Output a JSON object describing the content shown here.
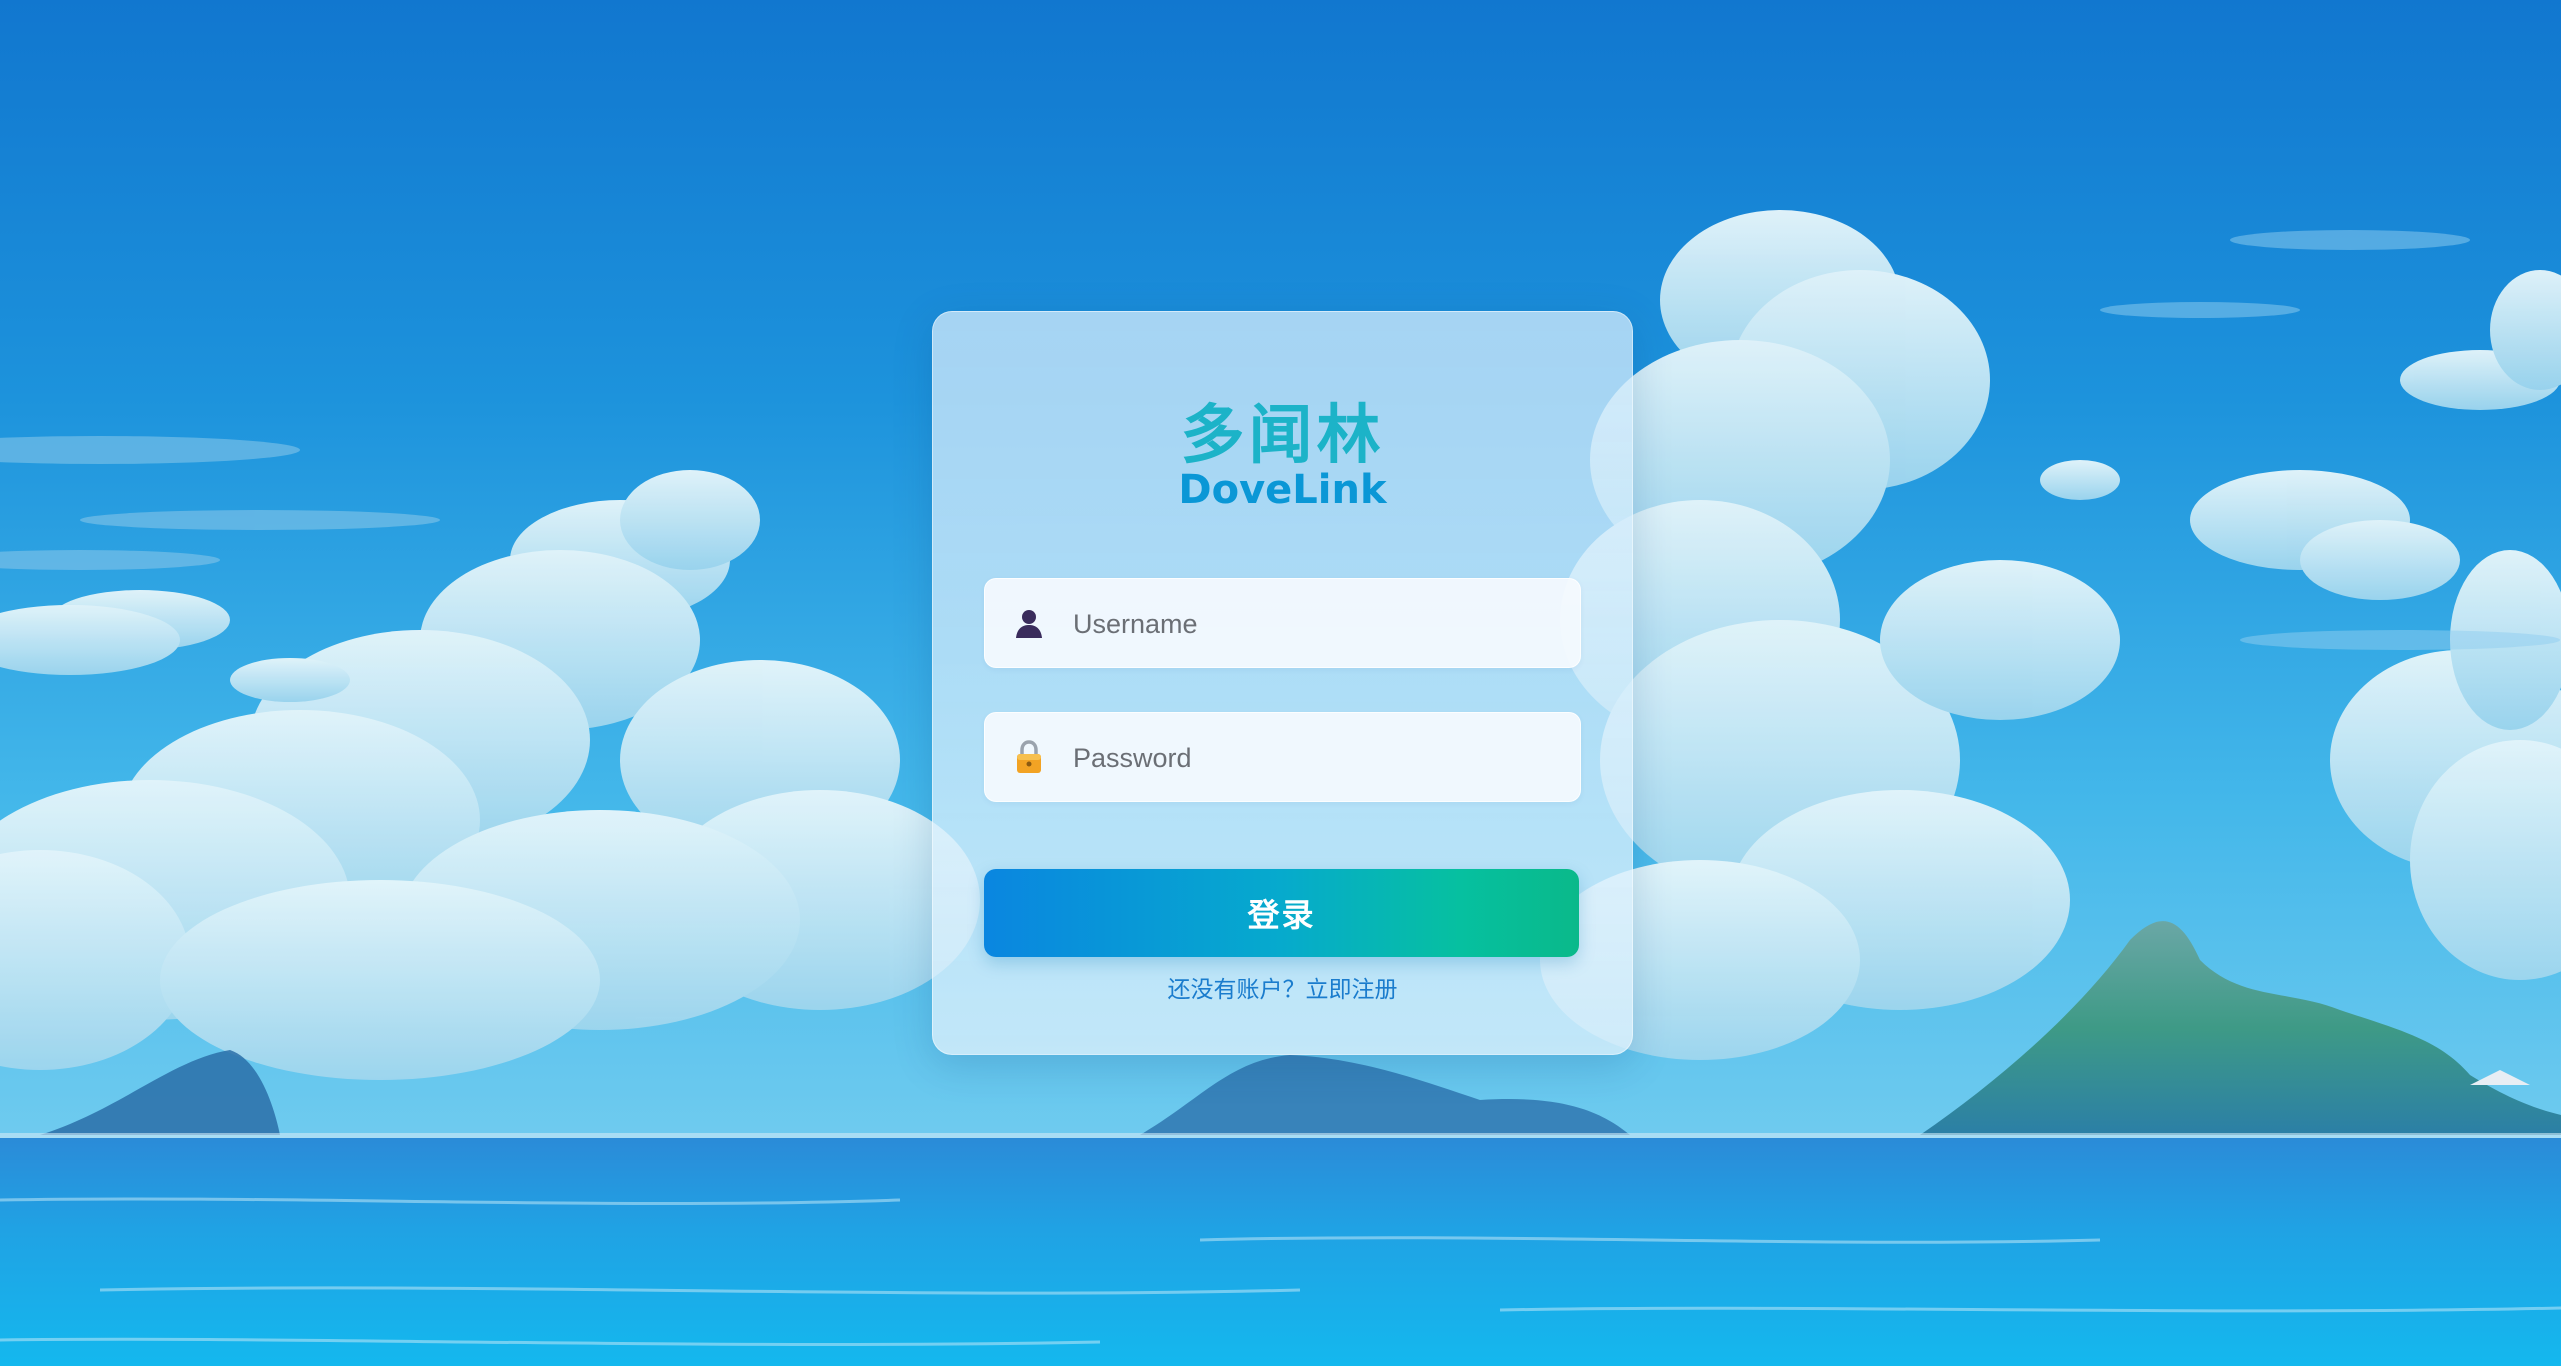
{
  "app": {
    "title_cn": "多闻林",
    "title_en": "DoveLink"
  },
  "form": {
    "username": {
      "placeholder": "Username",
      "value": "",
      "icon": "user-icon"
    },
    "password": {
      "placeholder": "Password",
      "value": "",
      "icon": "lock-icon"
    },
    "login_label": "登录",
    "register_text": "还没有账户？立即注册"
  },
  "colors": {
    "title_cn": "#1cb3c8",
    "title_en": "#0a97d6",
    "button_start": "#0a86e0",
    "button_end": "#0ab98a",
    "link": "#1a7ccd"
  }
}
